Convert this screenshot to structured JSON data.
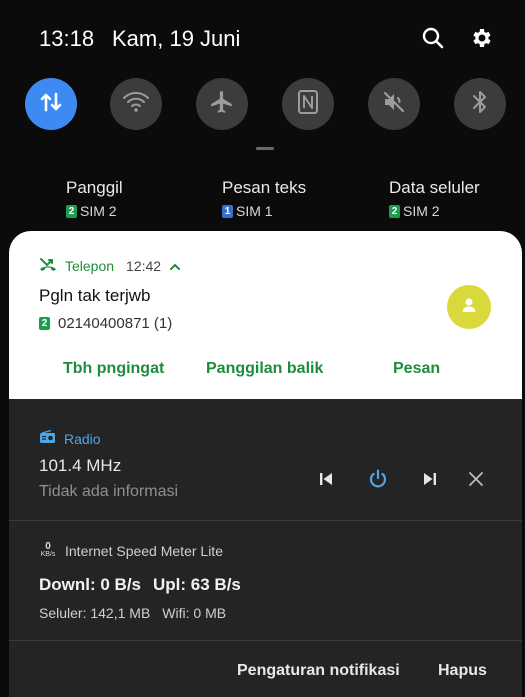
{
  "status_bar": {
    "time": "13:18",
    "date": "Kam, 19 Juni"
  },
  "quick_settings": [
    {
      "name": "data-transfer",
      "icon": "up-down-arrows-icon",
      "active": true
    },
    {
      "name": "wifi",
      "icon": "wifi-icon",
      "active": false
    },
    {
      "name": "airplane",
      "icon": "airplane-icon",
      "active": false
    },
    {
      "name": "nfc",
      "icon": "nfc-icon",
      "active": false
    },
    {
      "name": "sound",
      "icon": "mute-icon",
      "active": false
    },
    {
      "name": "bluetooth",
      "icon": "bluetooth-icon",
      "active": false
    }
  ],
  "sim_settings": [
    {
      "title": "Panggil",
      "sim": "SIM 2",
      "badge": "2",
      "badge_color": "#1f9c4f"
    },
    {
      "title": "Pesan teks",
      "sim": "SIM 1",
      "badge": "1",
      "badge_color": "#3a6fc9"
    },
    {
      "title": "Data seluler",
      "sim": "SIM 2",
      "badge": "2",
      "badge_color": "#1f9c4f"
    }
  ],
  "call_notification": {
    "app": "Telepon",
    "time": "12:42",
    "title": "Pgln tak terjwb",
    "sim_badge": "2",
    "number": "02140400871 (1)",
    "actions": [
      "Tbh pngingat",
      "Panggilan balik",
      "Pesan"
    ],
    "accent": "#1e8c3c"
  },
  "radio_notification": {
    "app": "Radio",
    "frequency": "101.4 MHz",
    "info": "Tidak ada informasi",
    "accent": "#4ea6e8"
  },
  "speed_notification": {
    "app": "Internet Speed Meter Lite",
    "icon_value": "0",
    "icon_unit": "KB/s",
    "download": "Downl: 0 B/s",
    "upload": "Upl: 63 B/s",
    "mobile": "Seluler: 142,1 MB",
    "wifi": "Wifi: 0 MB"
  },
  "footer": {
    "settings": "Pengaturan notifikasi",
    "clear": "Hapus"
  }
}
